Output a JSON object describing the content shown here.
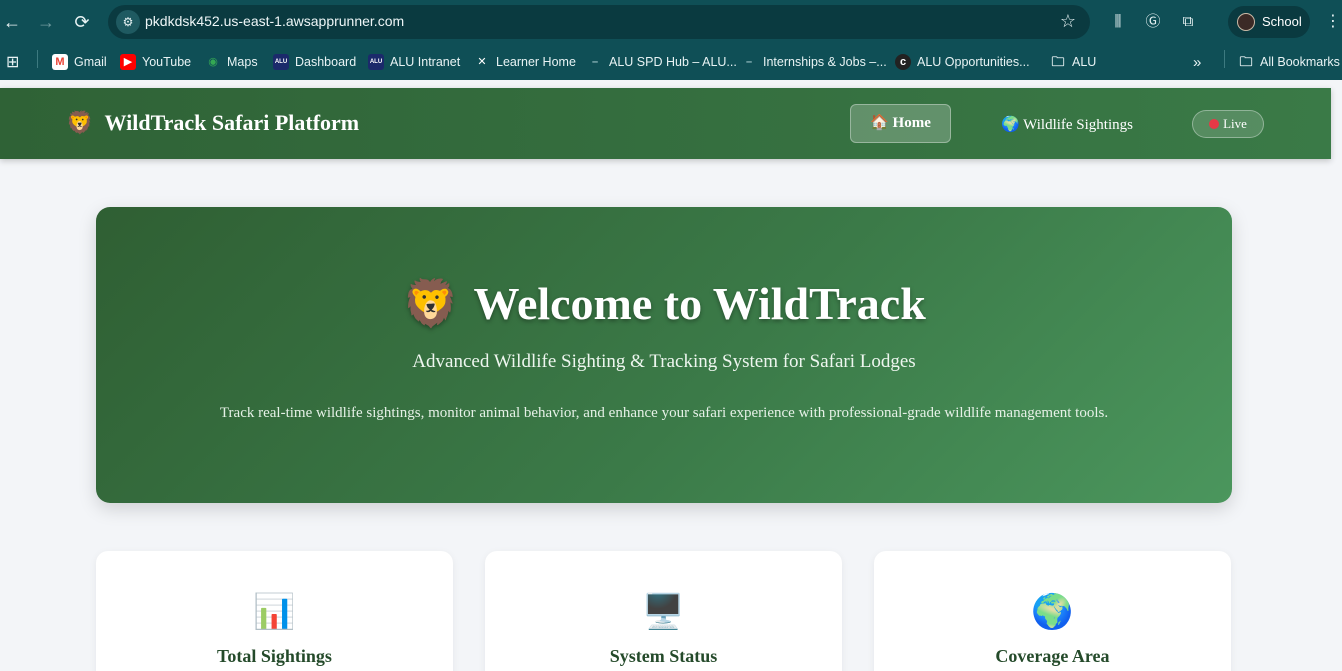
{
  "browser": {
    "url": "pkdkdsk452.us-east-1.awsapprunner.com",
    "profile_label": "School",
    "bookmarks": [
      {
        "label": "Gmail",
        "icon": "gmail-icon"
      },
      {
        "label": "YouTube",
        "icon": "youtube-icon"
      },
      {
        "label": "Maps",
        "icon": "maps-icon"
      },
      {
        "label": "Dashboard",
        "icon": "alu-icon"
      },
      {
        "label": "ALU Intranet",
        "icon": "alu-icon"
      },
      {
        "label": "Learner Home",
        "icon": "x-icon"
      },
      {
        "label": "ALU SPD Hub – ALU...",
        "icon": "dash-icon"
      },
      {
        "label": "Internships & Jobs –...",
        "icon": "dash-icon"
      },
      {
        "label": "ALU Opportunities...",
        "icon": "circle-icon"
      },
      {
        "label": "ALU",
        "icon": "folder-icon"
      }
    ],
    "all_bookmarks": "All Bookmarks"
  },
  "header": {
    "brand_icon": "🦁",
    "brand": "WildTrack Safari Platform",
    "nav": {
      "home_icon": "🏠",
      "home": "Home",
      "sightings_icon": "🌍",
      "sightings": "Wildlife Sightings",
      "live": "Live"
    }
  },
  "hero": {
    "emoji": "🦁",
    "title": "Welcome to WildTrack",
    "subtitle": "Advanced Wildlife Sighting & Tracking System for Safari Lodges",
    "description": "Track real-time wildlife sightings, monitor animal behavior, and enhance your safari experience with professional-grade wildlife management tools."
  },
  "cards": [
    {
      "icon": "📊",
      "title": "Total Sightings"
    },
    {
      "icon": "🖥️",
      "title": "System Status"
    },
    {
      "icon": "🌍",
      "title": "Coverage Area"
    }
  ],
  "colors": {
    "chrome": "#0f4f56",
    "header_green": "#2f6236",
    "hero_green": "#3b7a48",
    "live_dot": "#e63946"
  }
}
